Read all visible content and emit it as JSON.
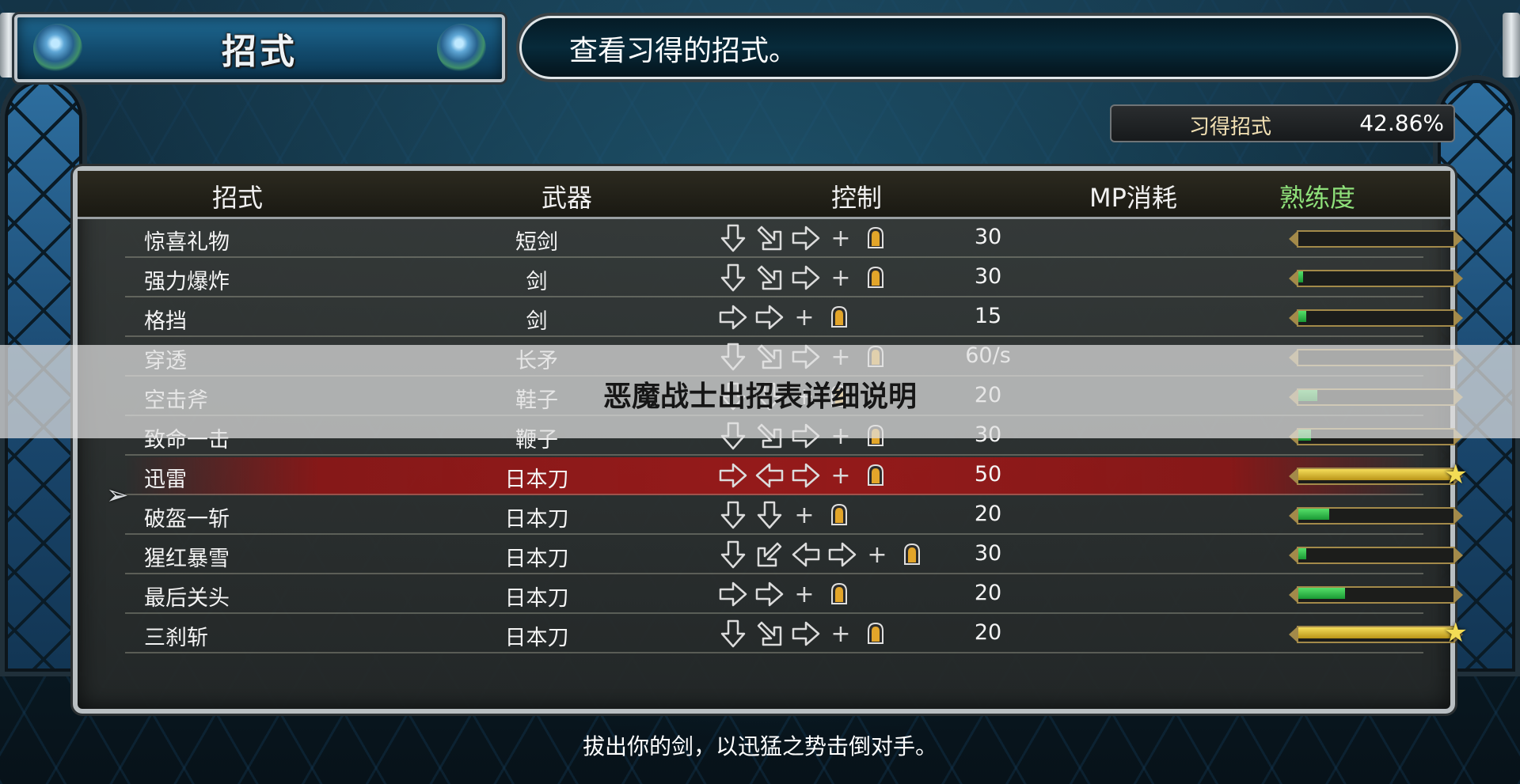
{
  "header": {
    "title": "招式",
    "hint": "查看习得的招式。"
  },
  "completion": {
    "label": "习得招式",
    "value": "42.86%"
  },
  "table": {
    "columns": {
      "name": "招式",
      "weapon": "武器",
      "control": "控制",
      "mp": "MP消耗",
      "proficiency": "熟练度"
    },
    "rows": [
      {
        "name": "惊喜礼物",
        "weapon": "短剑",
        "mp": "30",
        "input": [
          "down",
          "down-right",
          "right",
          "plus",
          "button"
        ],
        "proficiency": 0.0
      },
      {
        "name": "强力爆炸",
        "weapon": "剑",
        "mp": "30",
        "input": [
          "down",
          "down-right",
          "right",
          "plus",
          "button"
        ],
        "proficiency": 0.03
      },
      {
        "name": "格挡",
        "weapon": "剑",
        "mp": "15",
        "input": [
          "right",
          "right",
          "plus",
          "button"
        ],
        "proficiency": 0.05
      },
      {
        "name": "穿透",
        "weapon": "长矛",
        "mp": "60/s",
        "input": [
          "down",
          "down-right",
          "right",
          "plus",
          "button"
        ],
        "proficiency": 0.0
      },
      {
        "name": "空击斧",
        "weapon": "鞋子",
        "mp": "20",
        "input": [
          "down",
          "down",
          "plus",
          "button"
        ],
        "proficiency": 0.12
      },
      {
        "name": "致命一击",
        "weapon": "鞭子",
        "mp": "30",
        "input": [
          "down",
          "down-right",
          "right",
          "plus",
          "button"
        ],
        "proficiency": 0.08
      },
      {
        "name": "迅雷",
        "weapon": "日本刀",
        "mp": "50",
        "input": [
          "right",
          "left",
          "right",
          "plus",
          "button"
        ],
        "proficiency": 1.0,
        "selected": true
      },
      {
        "name": "破盔一斩",
        "weapon": "日本刀",
        "mp": "20",
        "input": [
          "down",
          "down",
          "plus",
          "button"
        ],
        "proficiency": 0.2
      },
      {
        "name": "猩红暴雪",
        "weapon": "日本刀",
        "mp": "30",
        "input": [
          "down",
          "down-left",
          "left",
          "right",
          "plus",
          "button"
        ],
        "proficiency": 0.05
      },
      {
        "name": "最后关头",
        "weapon": "日本刀",
        "mp": "20",
        "input": [
          "right",
          "right",
          "plus",
          "button"
        ],
        "proficiency": 0.3
      },
      {
        "name": "三刹斩",
        "weapon": "日本刀",
        "mp": "20",
        "input": [
          "down",
          "down-right",
          "right",
          "plus",
          "button"
        ],
        "proficiency": 1.0
      }
    ]
  },
  "overlay": {
    "text": "恶魔战士出招表详细说明"
  },
  "description": "拔出你的剑，以迅猛之势击倒对手。",
  "icons": {
    "cursor": "pointer-arrow-icon",
    "max_star": "star-icon",
    "plus": "plus-icon",
    "button": "attack-button-icon"
  },
  "colors": {
    "selected_row": "#9c1616",
    "bar_green": "#2fbd47",
    "bar_gold": "#e0c23a",
    "proficiency_header": "#8ee07a"
  }
}
